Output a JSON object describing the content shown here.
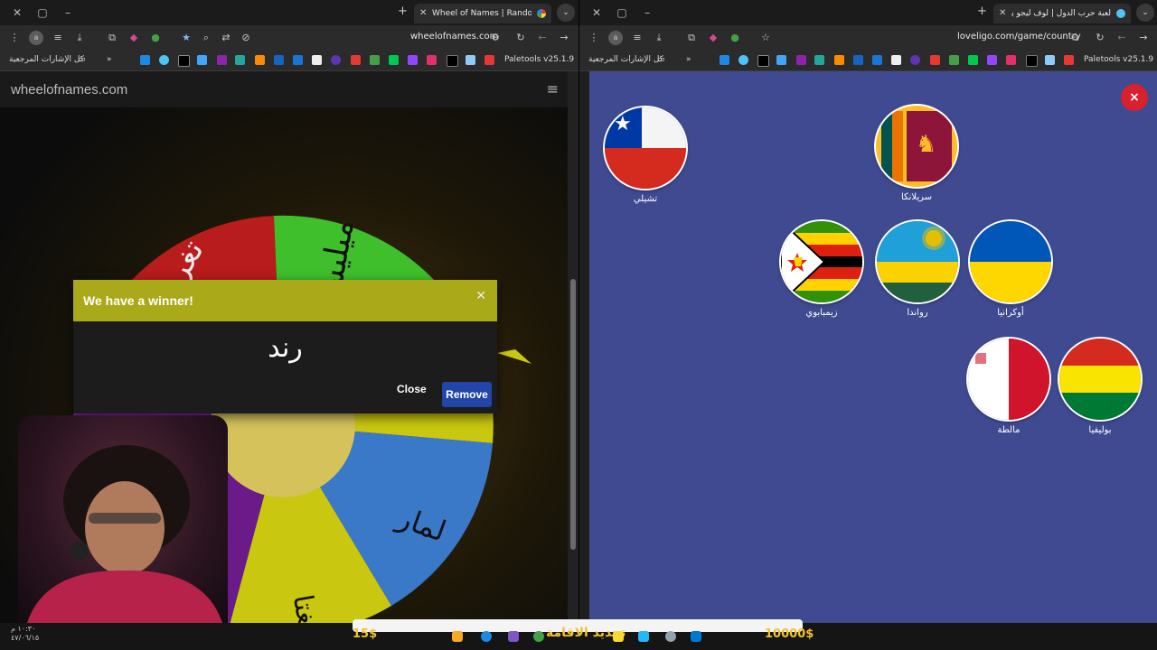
{
  "left_browser": {
    "tab_title": "Wheel of Names | Random nam",
    "address": "wheelofnames.com",
    "bookmarks_all_label": "كل الإشارات المرجعية",
    "paletools_label": "Paletools v25.1.9"
  },
  "right_browser": {
    "tab_title": "لعبة حرب الدول | لوف ليجو يوفر",
    "address": "loveligo.com/game/country",
    "bookmarks_all_label": "كل الإشارات المرجعية",
    "paletools_label": "Paletools v25.1.9"
  },
  "wheel_page": {
    "site_name": "wheelofnames.com",
    "segments": [
      "تغريد",
      "ميليساء",
      "لمار",
      "تغتا"
    ],
    "dialog": {
      "title": "We have a winner!",
      "winner": "رند",
      "close_label": "Close",
      "remove_label": "Remove",
      "close_icon": "close-icon"
    }
  },
  "game_page": {
    "close_label": "×",
    "flags": [
      {
        "name": "تشيلي"
      },
      {
        "name": "سريلانكا"
      },
      {
        "name": "زيمبابوي"
      },
      {
        "name": "رواندا"
      },
      {
        "name": "أوكرانيا"
      },
      {
        "name": "مالطة"
      },
      {
        "name": "بوليفيا"
      }
    ]
  },
  "taskbar": {
    "time": "١٠:٣٠ م",
    "date": "٤٧/٠٦/١٥",
    "money_left": "15$",
    "money_right": "10000$",
    "renew_label": "تجديد الاقامة"
  },
  "colors": {
    "dialog_header": "#a9a91a",
    "remove_button": "#2246a8",
    "game_background": "#3f4a91",
    "close_game": "#d8202f"
  }
}
